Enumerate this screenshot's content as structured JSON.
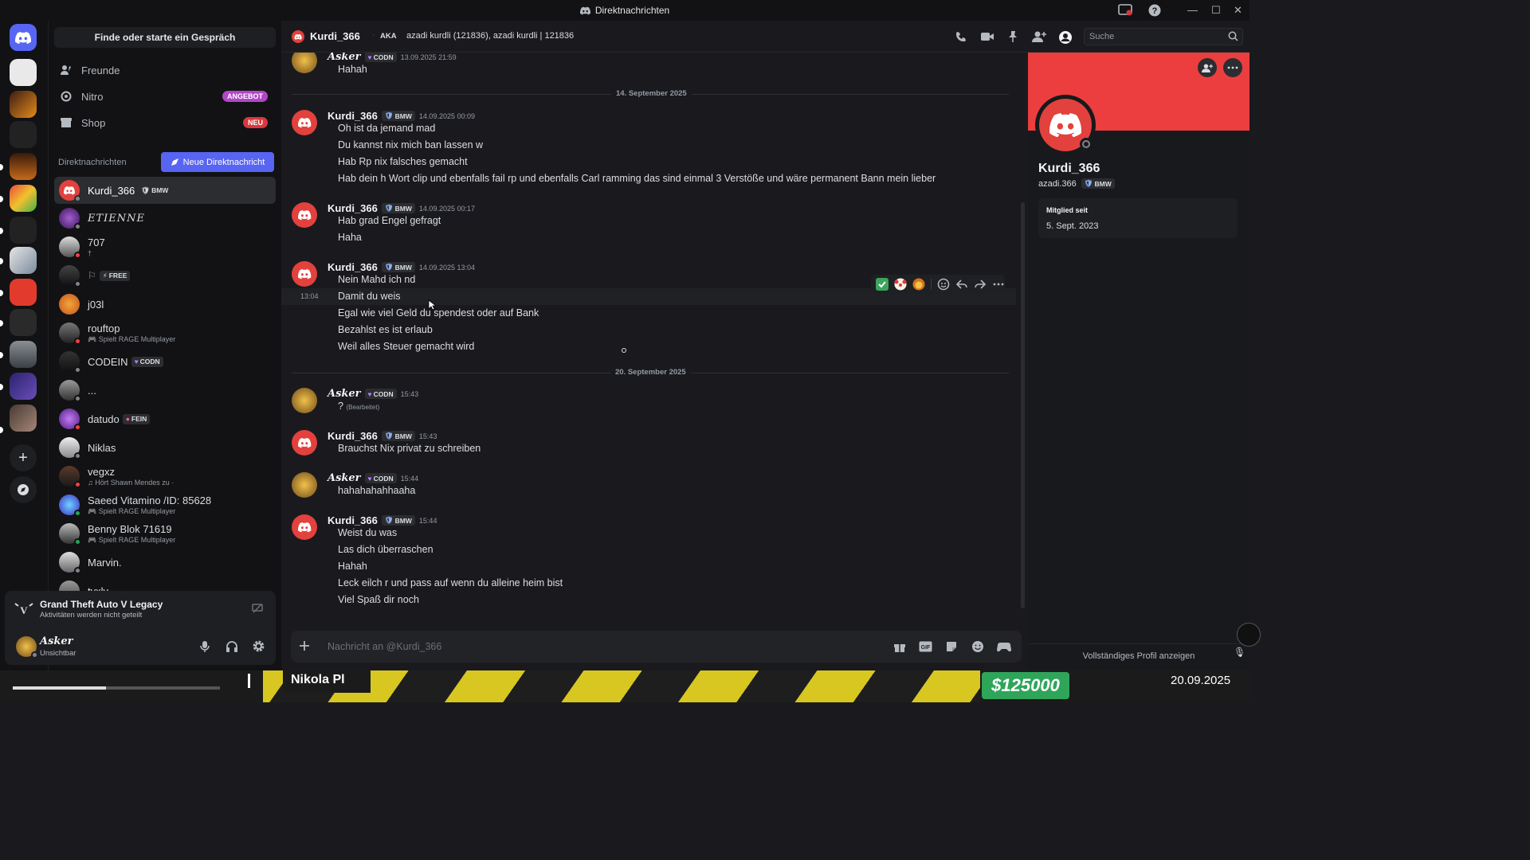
{
  "window": {
    "title": "Direktnachrichten"
  },
  "sidebar": {
    "search_button": "Finde oder starte ein Gespräch",
    "nav": [
      {
        "label": "Freunde",
        "badge": ""
      },
      {
        "label": "Nitro",
        "badge": "ANGEBOT"
      },
      {
        "label": "Shop",
        "badge": "NEU"
      }
    ],
    "dm_header": "Direktnachrichten",
    "new_dm_label": "Neue Direktnachricht",
    "dms": [
      {
        "name": "Kurdi_366",
        "tag": "BMW",
        "sub": "",
        "active": true
      },
      {
        "name": "ETIENNE",
        "tag": "",
        "sub": ""
      },
      {
        "name": "707",
        "tag": "",
        "sub": "†"
      },
      {
        "name": "",
        "tag": "FREE",
        "sub": ""
      },
      {
        "name": "j03l",
        "tag": "",
        "sub": ""
      },
      {
        "name": "rouftop",
        "tag": "",
        "sub": "Spielt RAGE Multiplayer"
      },
      {
        "name": "CODEIN",
        "tag": "CODN",
        "sub": ""
      },
      {
        "name": "...",
        "tag": "",
        "sub": ""
      },
      {
        "name": "datudo",
        "tag": "FEIN",
        "sub": ""
      },
      {
        "name": "Niklas",
        "tag": "",
        "sub": ""
      },
      {
        "name": "vegxz",
        "tag": "",
        "sub": "Hört Shawn Mendes zu ·"
      },
      {
        "name": "Saeed Vitamino /ID: 85628",
        "tag": "",
        "sub": "Spielt RAGE Multiplayer"
      },
      {
        "name": "Benny Blok 71619",
        "tag": "",
        "sub": "Spielt RAGE Multiplayer"
      },
      {
        "name": "Marvin.",
        "tag": "",
        "sub": ""
      },
      {
        "name": "tyxly",
        "tag": "",
        "sub": ""
      }
    ],
    "activity": {
      "title": "Grand Theft Auto V Legacy",
      "sub": "Aktivitäten werden nicht geteilt"
    },
    "user": {
      "name": "Asker",
      "status": "Unsichtbar"
    }
  },
  "header": {
    "channel_name": "Kurdi_366",
    "aka_label": "AKA",
    "aka_names": "azadi kurdli (121836), azadi kurdli | 121836",
    "search_placeholder": "Suche"
  },
  "chat": {
    "top_message": {
      "author": "Asker",
      "tag": "CODN",
      "time": "13.09.2025 21:59",
      "text": "Hahah"
    },
    "date_sep_1": "14. September 2025",
    "group1": {
      "author": "Kurdi_366",
      "tag": "BMW",
      "time": "14.09.2025 00:09",
      "lines": [
        "Oh ist da jemand mad",
        "Du kannst nix mich ban lassen w",
        "Hab Rp nix falsches gemacht",
        "Hab dein h Wort clip und ebenfalls fail rp und ebenfalls Carl ramming das sind einmal 3 Verstöße und wäre permanent Bann mein lieber"
      ]
    },
    "group2": {
      "author": "Kurdi_366",
      "tag": "BMW",
      "time": "14.09.2025 00:17",
      "lines": [
        "Hab grad Engel gefragt",
        "Haha"
      ]
    },
    "group3": {
      "author": "Kurdi_366",
      "tag": "BMW",
      "time": "14.09.2025 13:04",
      "hover_time": "13:04",
      "lines": [
        "Nein Mahd ich nd",
        "Damit du weis",
        "Egal wie viel Geld du spendest oder auf Bank",
        "Bezahlst es ist erlaub",
        "Weil alles Steuer gemacht wird"
      ]
    },
    "date_sep_2": "20. September 2025",
    "group4": {
      "author": "Asker",
      "tag": "CODN",
      "time": "15:43",
      "text": "?",
      "edited": "(Bearbeitet)"
    },
    "group5": {
      "author": "Kurdi_366",
      "tag": "BMW",
      "time": "15:43",
      "lines": [
        "Brauchst Nix privat zu schreiben"
      ]
    },
    "group6": {
      "author": "Asker",
      "tag": "CODN",
      "time": "15:44",
      "lines": [
        "hahahahahhaaha"
      ]
    },
    "group7": {
      "author": "Kurdi_366",
      "tag": "BMW",
      "time": "15:44",
      "lines": [
        "Weist du was",
        "Las dich überraschen",
        "Hahah",
        "Leck eilch r und pass auf wenn du alleine heim bist",
        "Viel Spaß dir noch"
      ]
    },
    "composer_placeholder": "Nachricht an @Kurdi_366"
  },
  "profile": {
    "name": "Kurdi_366",
    "username": "azadi.366",
    "tag": "BMW",
    "member_since_label": "Mitglied seit",
    "member_since": "5. Sept. 2023",
    "full_profile": "Vollständiges Profil anzeigen"
  },
  "game": {
    "player": "Nikola Pl",
    "money": "$125000",
    "date": "20.09.2025"
  },
  "colors": {
    "accent": "#5865f2",
    "banner": "#ec3e3f",
    "discord_red": "#e3413d",
    "money_green": "#2fa55a"
  }
}
